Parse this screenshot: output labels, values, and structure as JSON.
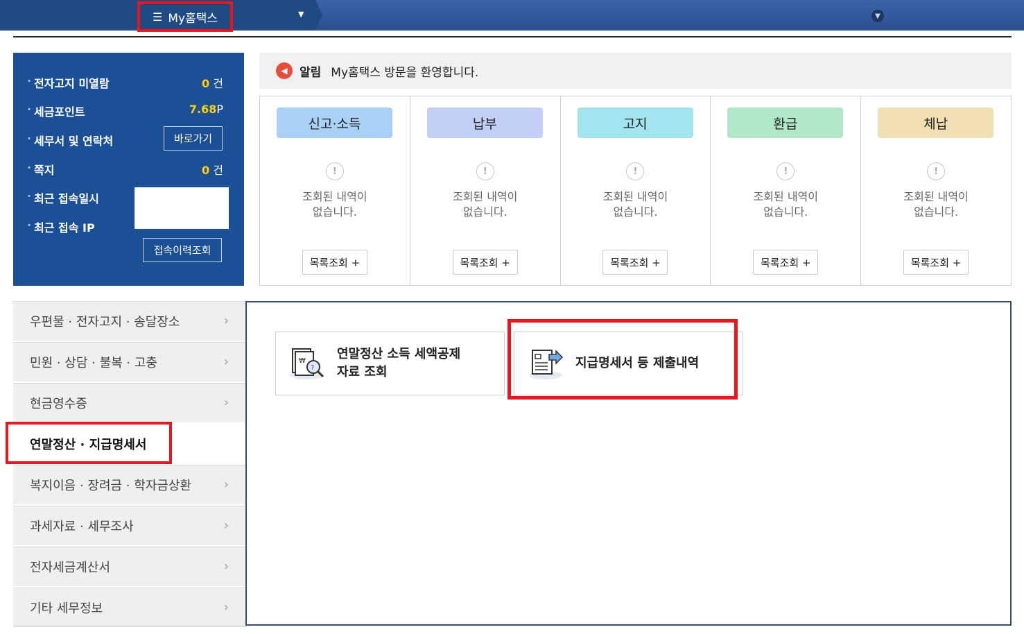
{
  "topbar": {
    "menu_label": "My홈택스",
    "menu_icon": "hamburger-icon"
  },
  "info": {
    "unread_label": "전자고지 미열람",
    "unread_count": "0",
    "unread_unit": "건",
    "points_label": "세금포인트",
    "points_value": "7.68",
    "points_unit": "P",
    "office_label": "세무서 및 연락처",
    "office_button": "바로가기",
    "note_label": "쪽지",
    "note_count": "0",
    "note_unit": "건",
    "last_login_label": "최근 접속일시",
    "last_ip_label": "최근 접속 IP",
    "history_button": "접속이력조회"
  },
  "notice": {
    "label": "알림",
    "text": "My홈택스 방문을 환영합니다."
  },
  "cards": [
    {
      "title": "신고·소득",
      "color": "#a9d0f5",
      "empty": "조회된 내역이",
      "empty2": "없습니다.",
      "button": "목록조회 +"
    },
    {
      "title": "납부",
      "color": "#c2cff7",
      "empty": "조회된 내역이",
      "empty2": "없습니다.",
      "button": "목록조회 +"
    },
    {
      "title": "고지",
      "color": "#a3e4ee",
      "empty": "조회된 내역이",
      "empty2": "없습니다.",
      "button": "목록조회 +"
    },
    {
      "title": "환급",
      "color": "#b1e8c8",
      "empty": "조회된 내역이",
      "empty2": "없습니다.",
      "button": "목록조회 +"
    },
    {
      "title": "체납",
      "color": "#f1e0b3",
      "empty": "조회된 내역이",
      "empty2": "없습니다.",
      "button": "목록조회 +"
    }
  ],
  "sidebar": [
    {
      "label": "우편물 · 전자고지 · 송달장소"
    },
    {
      "label": "민원 · 상담 · 불복 · 고충"
    },
    {
      "label": "현금영수증"
    },
    {
      "label": "연말정산 · 지급명세서",
      "active": true
    },
    {
      "label": "복지이음 · 장려금 · 학자금상환"
    },
    {
      "label": "과세자료 · 세무조사"
    },
    {
      "label": "전자세금계산서"
    },
    {
      "label": "기타 세무정보"
    }
  ],
  "tiles": [
    {
      "line1": "연말정산 소득 세액공제",
      "line2": "자료 조회",
      "icon": "document-search-icon"
    },
    {
      "line1": "지급명세서 등 제출내역",
      "icon": "document-submit-icon"
    }
  ]
}
